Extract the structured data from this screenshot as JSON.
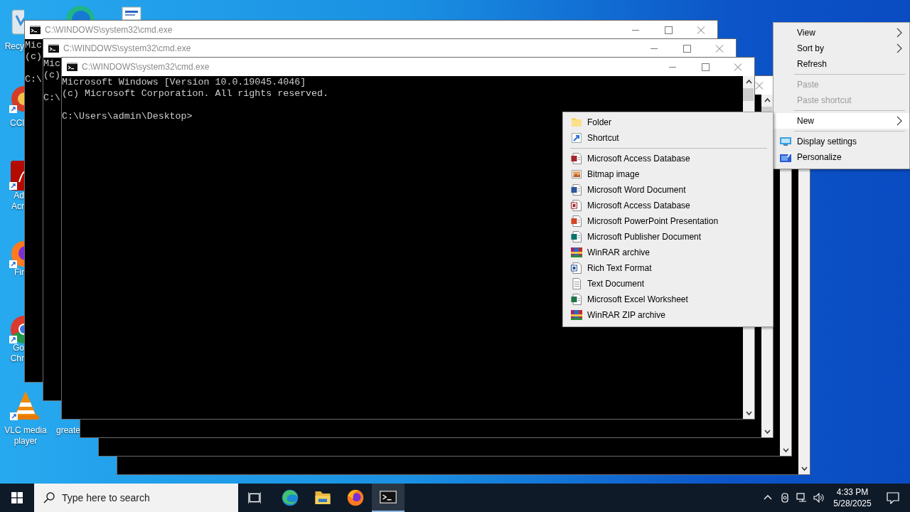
{
  "desktop_icons": [
    {
      "label": "Recy"
    },
    {
      "label": "CCl"
    },
    {
      "label": "Ad Acr"
    },
    {
      "label": "Fir"
    },
    {
      "label": "Go Chr"
    },
    {
      "label": "VLC media player"
    },
    {
      "label": "greate"
    }
  ],
  "windows": [
    {
      "title": "C:\\WINDOWS\\system32\\cmd.exe",
      "banner": [
        "Mic",
        "(c)"
      ],
      "prompt": "C:\\",
      "minimize_button": true,
      "maximize_button": true,
      "close_button": true
    },
    {
      "title": "C:\\WINDOWS\\system32\\cmd.exe",
      "banner": [
        "Mic",
        "(c)"
      ],
      "prompt": "C:\\",
      "minimize_button": true,
      "maximize_button": true,
      "close_button": true
    },
    {
      "title": "C:\\WINDOWS\\system32\\cmd.exe",
      "banner": [
        "Microsoft Windows [Version 10.0.19045.4046]",
        "(c) Microsoft Corporation. All rights reserved."
      ],
      "prompt": "C:\\Users\\admin\\Desktop>",
      "minimize_button": true,
      "maximize_button": true,
      "close_button": true,
      "scrollbar": true
    },
    {
      "minimize_button": false,
      "maximize_button": false,
      "close_button": true,
      "scrollbar": true
    },
    {
      "scrollbar": true
    },
    {
      "scrollbar": true
    }
  ],
  "context_menu": {
    "items": [
      {
        "kind": "item",
        "label": "View",
        "submenu": true,
        "disabled": false,
        "selected": false
      },
      {
        "kind": "item",
        "label": "Sort by",
        "submenu": true,
        "disabled": false,
        "selected": false
      },
      {
        "kind": "item",
        "label": "Refresh",
        "submenu": false,
        "disabled": false,
        "selected": false
      },
      {
        "kind": "separator"
      },
      {
        "kind": "item",
        "label": "Paste",
        "submenu": false,
        "disabled": true,
        "selected": false
      },
      {
        "kind": "item",
        "label": "Paste shortcut",
        "submenu": false,
        "disabled": true,
        "selected": false
      },
      {
        "kind": "separator"
      },
      {
        "kind": "item",
        "label": "New",
        "submenu": true,
        "disabled": false,
        "selected": true
      },
      {
        "kind": "separator"
      },
      {
        "kind": "item",
        "label": "Display settings",
        "submenu": false,
        "disabled": false,
        "selected": false
      },
      {
        "kind": "item",
        "label": "Personalize",
        "submenu": false,
        "disabled": false,
        "selected": false
      }
    ]
  },
  "new_submenu": {
    "items": [
      {
        "kind": "item",
        "label": "Folder"
      },
      {
        "kind": "item",
        "label": "Shortcut"
      },
      {
        "kind": "separator"
      },
      {
        "kind": "item",
        "label": "Microsoft Access Database"
      },
      {
        "kind": "item",
        "label": "Bitmap image"
      },
      {
        "kind": "item",
        "label": "Microsoft Word Document"
      },
      {
        "kind": "item",
        "label": "Microsoft Access Database"
      },
      {
        "kind": "item",
        "label": "Microsoft PowerPoint Presentation"
      },
      {
        "kind": "item",
        "label": "Microsoft Publisher Document"
      },
      {
        "kind": "item",
        "label": "WinRAR archive"
      },
      {
        "kind": "item",
        "label": "Rich Text Format"
      },
      {
        "kind": "item",
        "label": "Text Document"
      },
      {
        "kind": "item",
        "label": "Microsoft Excel Worksheet"
      },
      {
        "kind": "item",
        "label": "WinRAR ZIP archive"
      }
    ]
  },
  "taskbar": {
    "search": {
      "placeholder": "Type here to search"
    },
    "apps": [
      {
        "running": false
      },
      {
        "running": false
      },
      {
        "running": false
      },
      {
        "running": false
      },
      {
        "running": true
      }
    ],
    "clock": {
      "time": "4:33 PM",
      "date": "5/28/2025"
    }
  }
}
